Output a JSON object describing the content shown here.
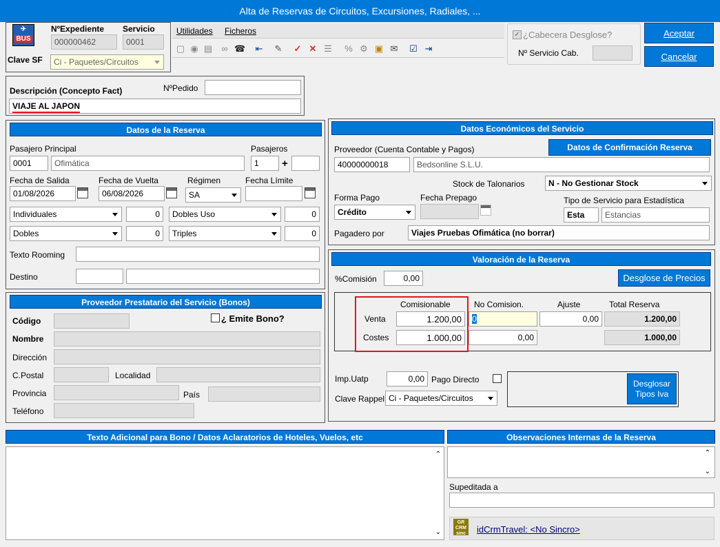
{
  "window": {
    "title": "Alta de Reservas de Circuitos, Excursiones, Radiales, ..."
  },
  "top": {
    "exp_label": "NºExpediente",
    "exp_value": "000000462",
    "serv_label": "Servicio",
    "serv_value": "0001",
    "clave_label": "Clave SF",
    "clave_value": "Ci - Paquetes/Circuitos"
  },
  "menu": {
    "utilidades": "Utilidades",
    "ficheros": "Ficheros"
  },
  "cabecera": {
    "label": "¿Cabecera Desglose?",
    "nserv_label": "Nº Servicio Cab."
  },
  "actions": {
    "aceptar": "Aceptar",
    "cancelar": "Cancelar"
  },
  "desc": {
    "label": "Descripción (Concepto Fact)",
    "pedido_label": "NºPedido",
    "value": "VIAJE AL JAPON"
  },
  "reserva": {
    "header": "Datos de la Reserva",
    "pasajero_label": "Pasajero Principal",
    "pasajero_code": "0001",
    "pasajero_name": "Ofimática",
    "pasajeros_label": "Pasajeros",
    "pasajeros_value": "1",
    "plus": "+",
    "salida_label": "Fecha de Salida",
    "salida_value": "01/08/2026",
    "vuelta_label": "Fecha de Vuelta",
    "vuelta_value": "06/08/2026",
    "regimen_label": "Régimen",
    "regimen_value": "SA",
    "limite_label": "Fecha Límite",
    "ind_label": "Individuales",
    "ind_value": "0",
    "du_label": "Dobles Uso",
    "du_value": "0",
    "dob_label": "Dobles",
    "dob_value": "0",
    "tri_label": "Triples",
    "tri_value": "0",
    "rooming_label": "Texto Rooming",
    "destino_label": "Destino"
  },
  "bonos": {
    "header": "Proveedor Prestatario del Servicio (Bonos)",
    "emite_label": "¿ Emite Bono?",
    "codigo": "Código",
    "nombre": "Nombre",
    "direccion": "Dirección",
    "cpostal": "C.Postal",
    "localidad": "Localidad",
    "provincia": "Provincia",
    "pais": "País",
    "telefono": "Teléfono"
  },
  "economicos": {
    "header": "Datos Económicos del Servicio",
    "confirm_btn": "Datos de Confirmación Reserva",
    "prov_label": "Proveedor (Cuenta Contable y Pagos)",
    "prov_code": "40000000018",
    "prov_name": "Bedsonline S.L.U.",
    "stock_label": "Stock de Talonarios",
    "stock_value": "N - No Gestionar Stock",
    "forma_label": "Forma Pago",
    "forma_value": "Crédito",
    "prepago_label": "Fecha Prepago",
    "tipo_label": "Tipo de Servicio para Estadística",
    "tipo_code": "Esta",
    "tipo_name": "Estancias",
    "pagadero_label": "Pagadero por",
    "pagadero_value": "Viajes Pruebas Ofimática (no borrar)"
  },
  "valoracion": {
    "header": "Valoración de la Reserva",
    "comision_label": "%Comisión",
    "comision_value": "0,00",
    "desglose_btn": "Desglose de Precios",
    "col_comisionable": "Comisionable",
    "col_nocomision": "No Comision.",
    "col_ajuste": "Ajuste",
    "col_total": "Total Reserva",
    "venta_label": "Venta",
    "venta_com": "1.200,00",
    "venta_nocom": "0",
    "venta_ajuste": "0,00",
    "venta_total": "1.200,00",
    "costes_label": "Costes",
    "costes_com": "1.000,00",
    "costes_nocom": "0,00",
    "costes_total": "1.000,00",
    "uatp_label": "Imp.Uatp",
    "uatp_value": "0,00",
    "pago_directo": "Pago Directo",
    "rappel_label": "Clave Rappel",
    "rappel_value": "Ci - Paquetes/Circuitos",
    "iva_btn": "Desglosar Tipos Iva"
  },
  "bottom": {
    "texto_header": "Texto Adicional para Bono / Datos Aclaratorios de Hoteles, Vuelos, etc",
    "obs_header": "Observaciones Internas de la Reserva",
    "supeditada_label": "Supeditada a",
    "crm_link": "idCrmTravel: <No Sincro>"
  },
  "colors": {
    "accent": "#0078d7",
    "highlight": "#e81123"
  }
}
